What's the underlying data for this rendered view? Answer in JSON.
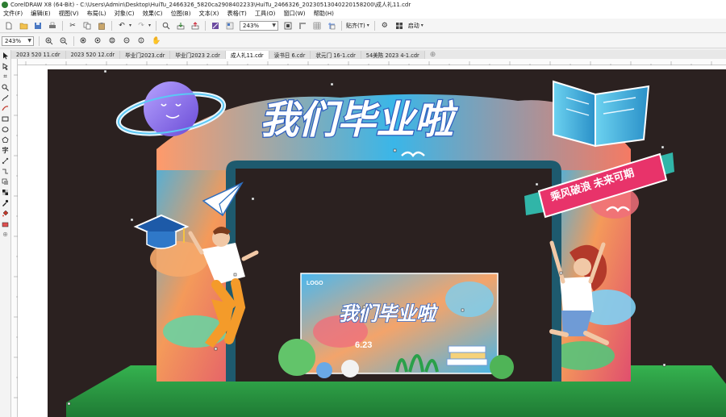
{
  "window": {
    "title": "CorelDRAW X8 (64-Bit) - C:\\Users\\Admin\\Desktop\\HuiTu_2466326_5820ca2908402233\\HuiTu_2466326_20230513040220158200\\成人礼11.cdr"
  },
  "menu": [
    "文件(F)",
    "编辑(E)",
    "视图(V)",
    "布局(L)",
    "对象(C)",
    "效果(C)",
    "位图(B)",
    "文本(X)",
    "表格(T)",
    "工具(O)",
    "窗口(W)",
    "帮助(H)"
  ],
  "toolbar": {
    "zoom_value": "243%",
    "snap_label": "贴齐(T)",
    "launch_label": "启动"
  },
  "propertybar": {
    "zoom_value": "243%"
  },
  "tabs": [
    "2023 520 11.cdr",
    "2023 520 12.cdr",
    "毕业门2023.cdr",
    "毕业门2023 2.cdr",
    "成人礼11.cdr",
    "读书日 6.cdr",
    "状元门 16-1.cdr",
    "54美陈 2023 4-1.cdr"
  ],
  "active_tab_index": 4,
  "artwork": {
    "main_title": "我们毕业啦",
    "banner_text": "乘风破浪 未来可期",
    "poster_title": "我们毕业啦",
    "poster_date": "6.23",
    "poster_logo": "LOGO"
  },
  "colors": {
    "canvas_dark": "#2b2120",
    "arch_teal": "#1e5a6e",
    "title_blue": "#3f7fe6",
    "grass": "#2fa44a",
    "banner_pink": "#e8336a"
  },
  "icons": {
    "planet": "planet-icon",
    "book": "open-book-icon",
    "grad_cap": "graduation-cap-icon",
    "paper_plane": "paper-plane-icon"
  }
}
